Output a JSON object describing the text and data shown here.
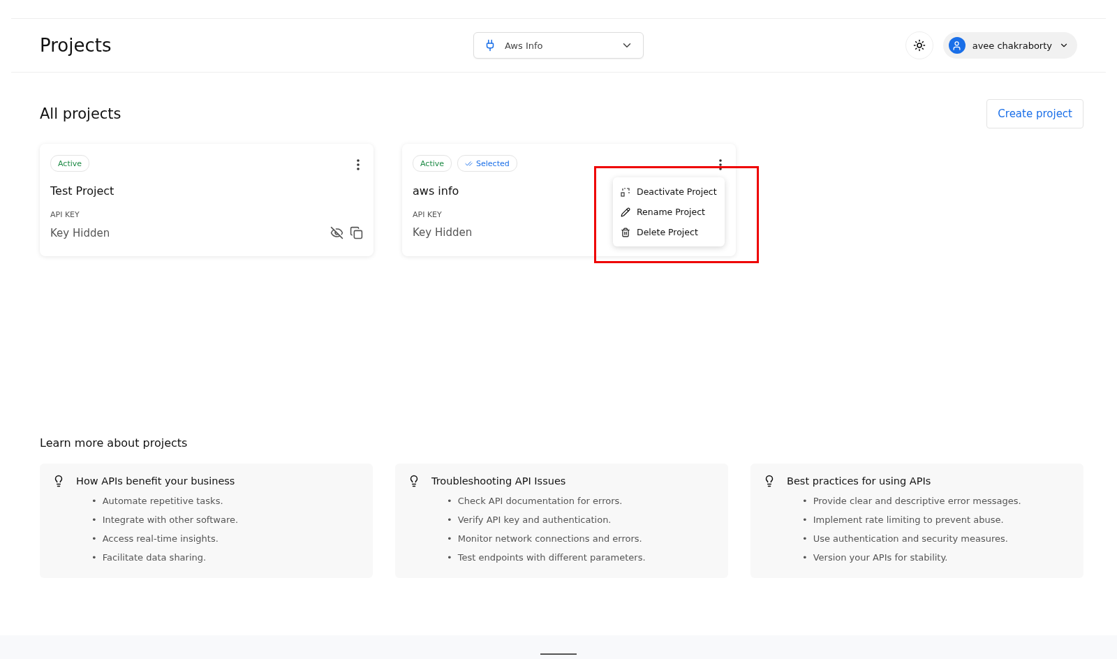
{
  "header": {
    "title": "Projects",
    "project_select": {
      "value": "Aws Info"
    },
    "user": {
      "name": "avee chakraborty"
    }
  },
  "section": {
    "title": "All projects",
    "create_button": "Create project"
  },
  "projects": [
    {
      "name": "Test Project",
      "badges": [
        {
          "kind": "status",
          "label": "Active"
        }
      ],
      "key_label": "API KEY",
      "key_value": "Key Hidden",
      "key_actions": true,
      "menu_open": false
    },
    {
      "name": "aws info",
      "badges": [
        {
          "kind": "status",
          "label": "Active"
        },
        {
          "kind": "selected",
          "label": "Selected"
        }
      ],
      "key_label": "API KEY",
      "key_value": "Key Hidden",
      "key_actions": false,
      "menu_open": true
    }
  ],
  "menu": {
    "highlighted": true,
    "items": [
      {
        "kind": "deactivate",
        "label": "Deactivate Project"
      },
      {
        "kind": "rename",
        "label": "Rename Project"
      },
      {
        "kind": "delete",
        "label": "Delete Project"
      }
    ]
  },
  "learn": {
    "title": "Learn more about projects",
    "cards": [
      {
        "title": "How APIs benefit your business",
        "items": [
          {
            "marker": "•",
            "text": "Automate repetitive tasks."
          },
          {
            "marker": "•",
            "text": "Integrate with other software."
          },
          {
            "marker": "•",
            "text": "Access real-time insights."
          },
          {
            "marker": "•",
            "text": "Facilitate data sharing."
          }
        ]
      },
      {
        "title": "Troubleshooting API Issues",
        "items": [
          {
            "marker": "•",
            "text": "Check API documentation for errors."
          },
          {
            "marker": "•",
            "text": "Verify API key and authentication."
          },
          {
            "marker": "•",
            "text": "Monitor network connections and errors."
          },
          {
            "marker": "•",
            "text": "Test endpoints with different parameters."
          }
        ]
      },
      {
        "title": "Best practices for using APIs",
        "items": [
          {
            "marker": "•",
            "text": "Provide clear and descriptive error messages."
          },
          {
            "marker": "•",
            "text": "Implement rate limiting to prevent abuse."
          },
          {
            "marker": "•",
            "text": "Use authentication and security measures."
          },
          {
            "marker": "•",
            "text": "Version your APIs for stability."
          }
        ]
      }
    ]
  }
}
